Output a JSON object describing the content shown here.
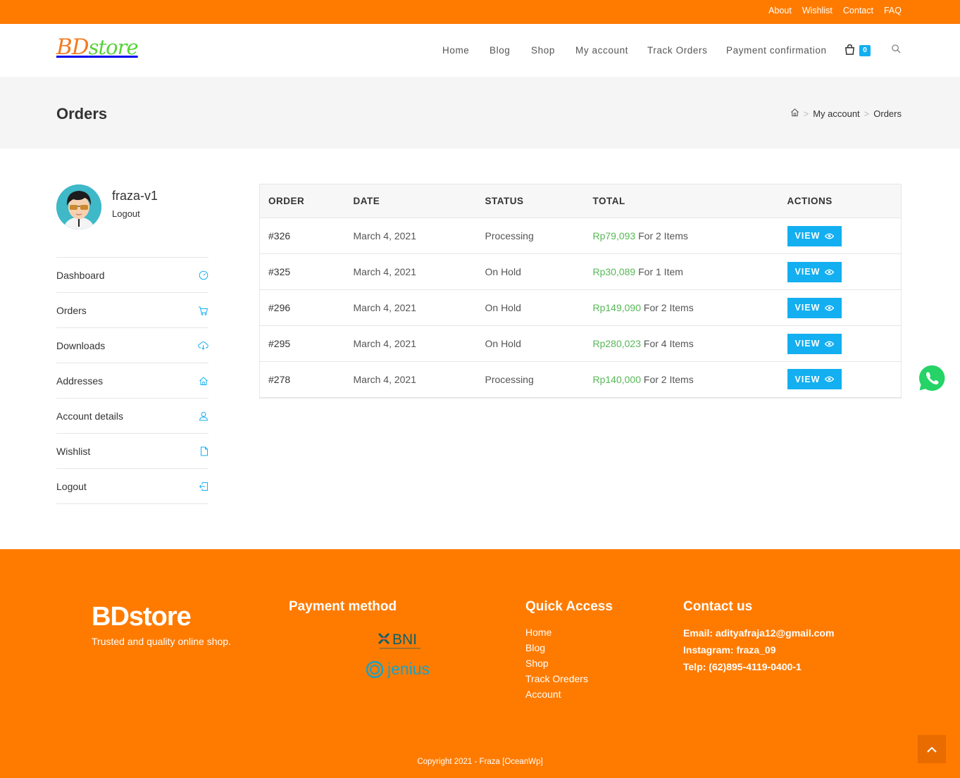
{
  "topbar": {
    "links": [
      "About",
      "Wishlist",
      "Contact",
      "FAQ"
    ]
  },
  "header": {
    "logo_bd": "BD",
    "logo_store": "store",
    "nav": [
      "Home",
      "Blog",
      "Shop",
      "My account",
      "Track Orders",
      "Payment confirmation"
    ],
    "cart_count": "0"
  },
  "page": {
    "title": "Orders",
    "breadcrumb": [
      "My account",
      "Orders"
    ]
  },
  "user": {
    "name": "fraza-v1",
    "logout": "Logout"
  },
  "account_nav": [
    {
      "label": "Dashboard",
      "icon": "dashboard-icon"
    },
    {
      "label": "Orders",
      "icon": "cart-icon"
    },
    {
      "label": "Downloads",
      "icon": "cloud-download-icon"
    },
    {
      "label": "Addresses",
      "icon": "home-icon"
    },
    {
      "label": "Account details",
      "icon": "user-icon"
    },
    {
      "label": "Wishlist",
      "icon": "document-icon"
    },
    {
      "label": "Logout",
      "icon": "logout-icon"
    }
  ],
  "orders": {
    "headers": [
      "ORDER",
      "DATE",
      "STATUS",
      "TOTAL",
      "ACTIONS"
    ],
    "rows": [
      {
        "order": "#326",
        "date": "March 4, 2021",
        "status": "Processing",
        "amount": "Rp79,093",
        "items": "For 2 Items",
        "action": "VIEW"
      },
      {
        "order": "#325",
        "date": "March 4, 2021",
        "status": "On Hold",
        "amount": "Rp30,089",
        "items": "For 1 Item",
        "action": "VIEW"
      },
      {
        "order": "#296",
        "date": "March 4, 2021",
        "status": "On Hold",
        "amount": "Rp149,090",
        "items": "For 2 Items",
        "action": "VIEW"
      },
      {
        "order": "#295",
        "date": "March 4, 2021",
        "status": "On Hold",
        "amount": "Rp280,023",
        "items": "For 4 Items",
        "action": "VIEW"
      },
      {
        "order": "#278",
        "date": "March 4, 2021",
        "status": "Processing",
        "amount": "Rp140,000",
        "items": "For 2 Items",
        "action": "VIEW"
      }
    ]
  },
  "footer": {
    "logo": "BDstore",
    "tagline": "Trusted and quality online shop.",
    "payment_heading": "Payment method",
    "payment_logos": [
      "BNI",
      "jenius"
    ],
    "quick_heading": "Quick Access",
    "quick_links": [
      "Home",
      "Blog",
      "Shop",
      "Track Oreders",
      "Account"
    ],
    "contact_heading": "Contact us",
    "contact": [
      "Email: adityafraja12@gmail.com",
      "Instagram: fraza_09",
      "Telp: (62)895-4119-0400-1"
    ],
    "copyright": "Copyright 2021 - Fraza [OceanWp]"
  },
  "colors": {
    "brand_orange": "#ff7b00",
    "accent_blue": "#13aff0",
    "price_green": "#57b857"
  }
}
